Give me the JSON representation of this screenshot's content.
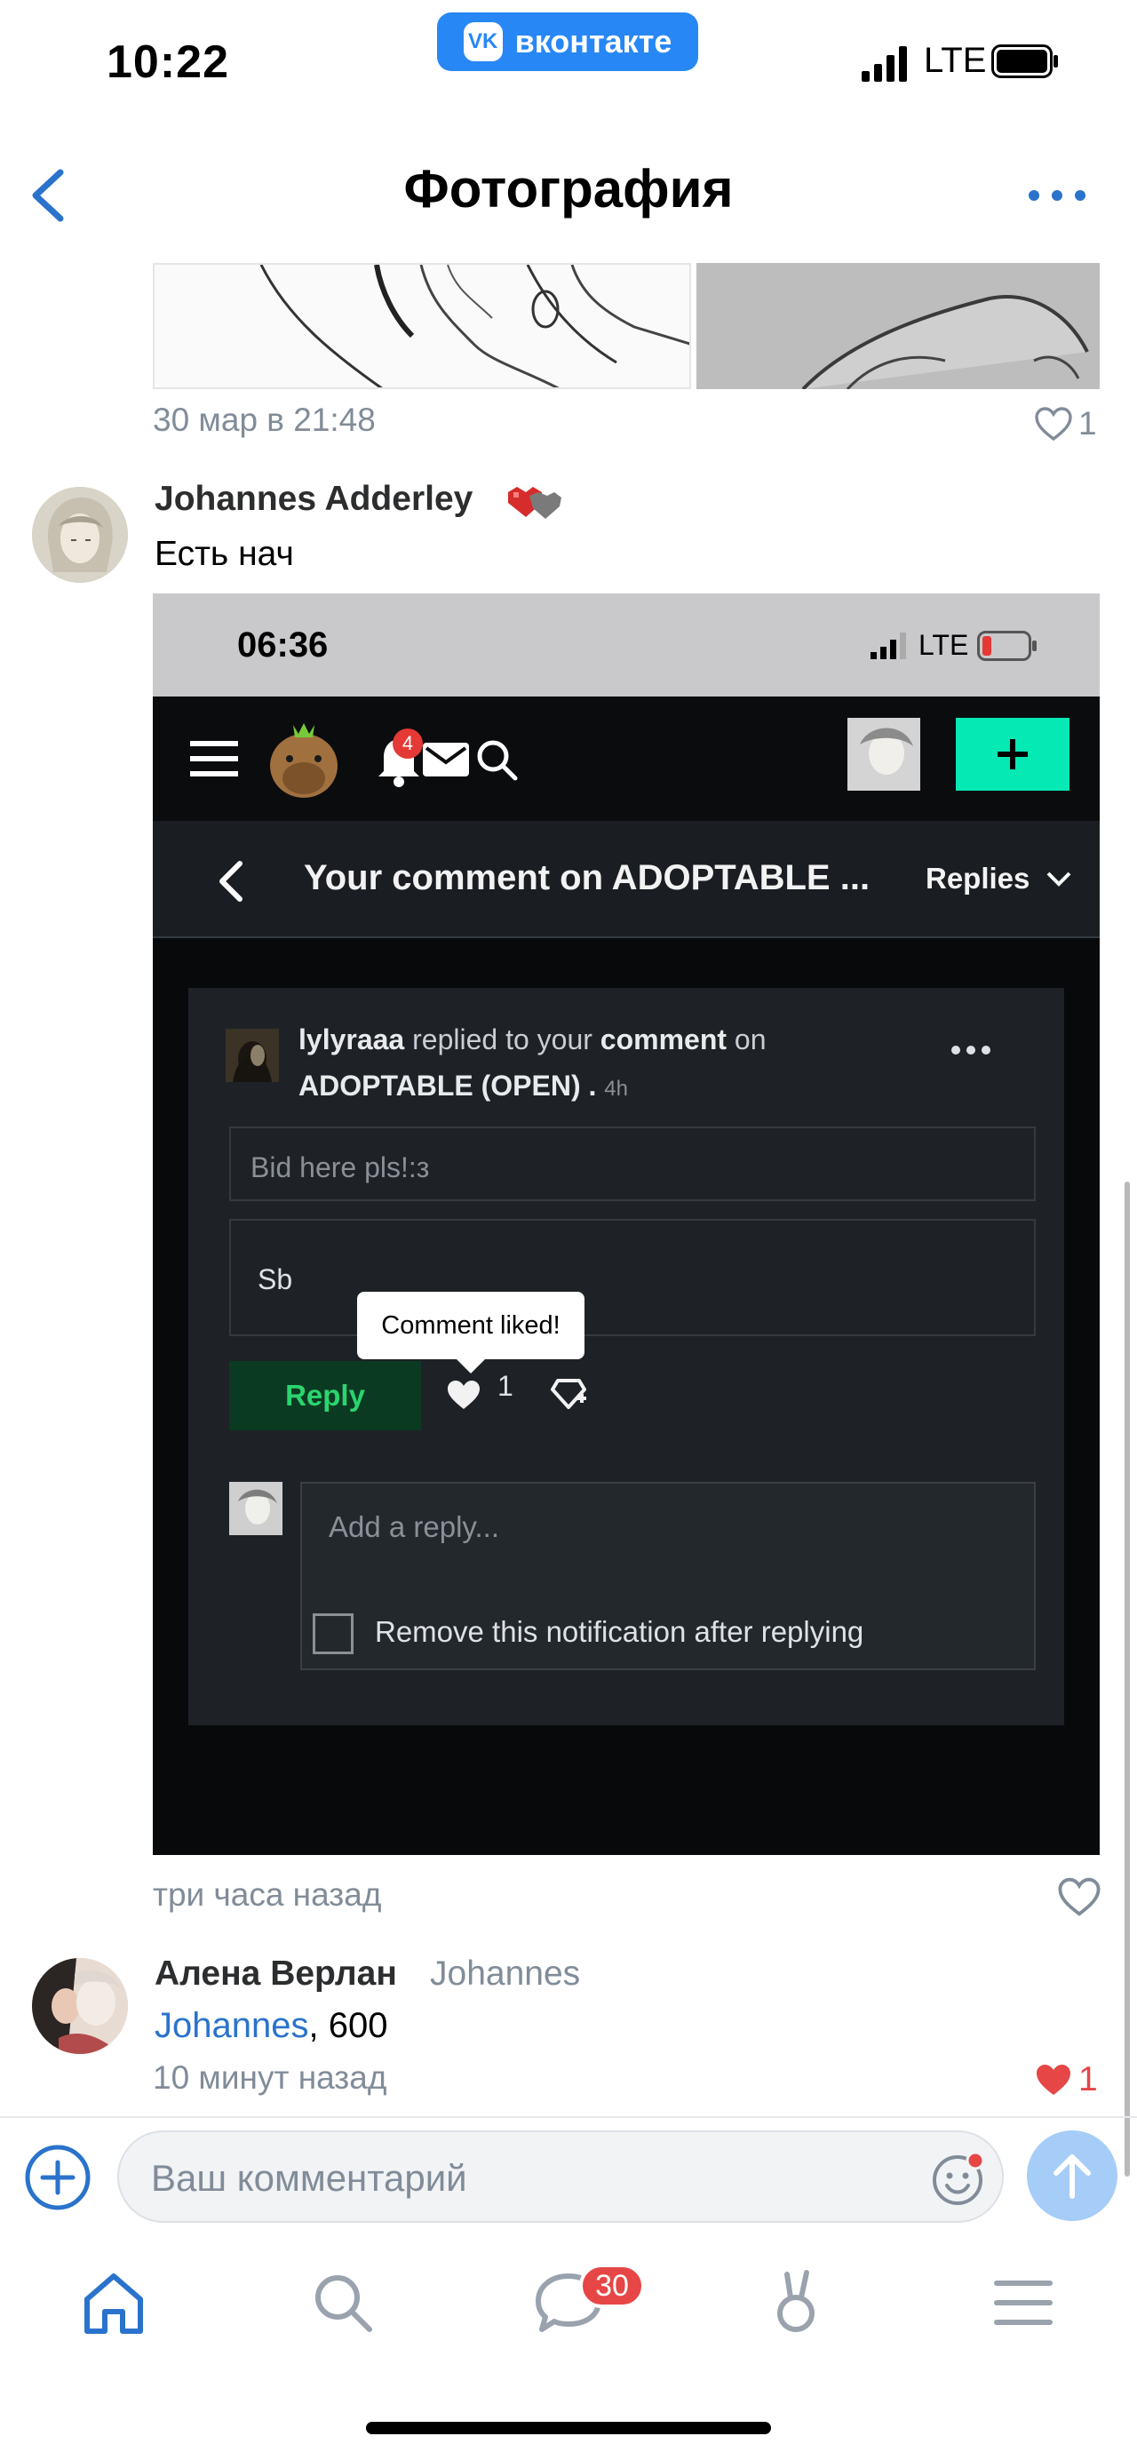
{
  "status_bar": {
    "time": "10:22",
    "network": "LTE",
    "app_badge": "вконтакте",
    "app_badge_logo": "VK"
  },
  "header": {
    "title": "Фотография"
  },
  "top_photo_post": {
    "date": "30 мар в 21:48",
    "likes": "1"
  },
  "comments": [
    {
      "author": "Johannes Adderley",
      "text": "Есть нач",
      "date": "три часа назад",
      "liked": false
    },
    {
      "author": "Алена Верлан",
      "reply_to": "Johannes",
      "mention": "Johannes",
      "text": ", 600",
      "date": "10 минут назад",
      "likes": "1",
      "liked": true
    }
  ],
  "embedded_screenshot": {
    "time": "06:36",
    "network": "LTE",
    "notification_badge": "4",
    "title": "Your comment on ADOPTABLE ...",
    "replies_label": "Replies",
    "notification": {
      "user": "lylyraaa",
      "action": "replied to your",
      "object": "comment",
      "on": "on",
      "target": "ADOPTABLE (OPEN) .",
      "age": "4h"
    },
    "original_comment": "Bid here pls!:з",
    "reply_text": "Sb",
    "tooltip": "Comment liked!",
    "reply_button": "Reply",
    "like_count": "1",
    "reply_placeholder": "Add a reply...",
    "remove_checkbox_label": "Remove this notification after replying"
  },
  "comment_bar": {
    "placeholder": "Ваш комментарий"
  },
  "tab_bar": {
    "messages_badge": "30"
  },
  "colors": {
    "vk_blue": "#2787f5",
    "link_blue": "#2a73cc",
    "like_red": "#e64646",
    "secondary_text": "#818c99",
    "send_disabled": "#a5cdf7",
    "reply_green": "#2bd46f"
  }
}
